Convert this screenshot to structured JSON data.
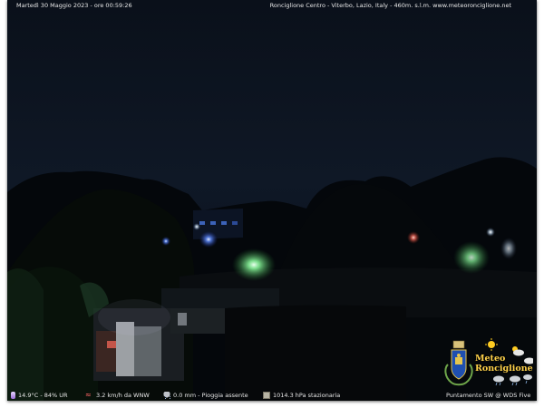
{
  "header": {
    "datetime": "Martedì 30 Maggio 2023 - ore 00:59:26",
    "location_and_site": "Ronciglione Centro - Viterbo, Lazio, Italy - 460m. s.l.m.    www.meteoronciglione.net"
  },
  "footer": {
    "temperature_humidity": "14.9°C - 84% UR",
    "wind": "3.2 km/h da WNW",
    "rain": "0.0 mm - Pioggia assente",
    "pressure": "1014.3 hPa stazionaria",
    "camera_credit": "Puntamento SW  @ WDS Five"
  },
  "logo": {
    "line1": "Meteo",
    "line2": "Ronciglione"
  },
  "icons": {
    "temperature": "thermometer-icon",
    "wind": "wind-icon",
    "rain": "rain-cloud-icon",
    "pressure": "barometer-icon",
    "weather": [
      "sun-icon",
      "partly-cloudy-icon",
      "cloud-icon",
      "rain-icon"
    ],
    "crest": "town-crest-icon"
  },
  "colors": {
    "sky": "#0c1420",
    "overlay_text": "#e8e8e8",
    "logo_text": "#ffd24a",
    "light_green": "#7dff9a",
    "light_blue": "#5f8cff",
    "light_red": "#ff6a5a"
  }
}
